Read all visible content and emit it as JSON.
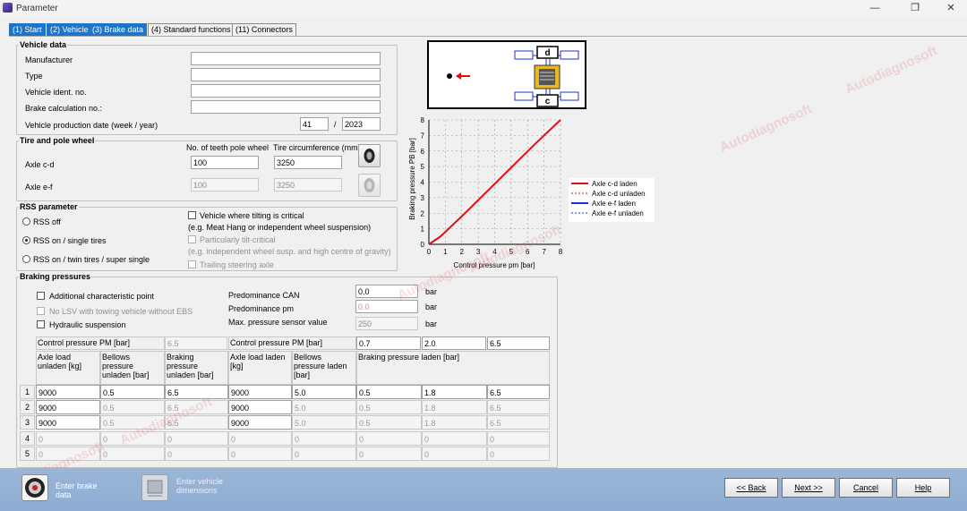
{
  "window": {
    "title": "Parameter",
    "min": "—",
    "max": "❐",
    "close": "✕"
  },
  "tabs": [
    "(1) Start",
    "(2) Vehicle",
    "(3) Brake data",
    "(4) Standard functions",
    "(11) Connectors"
  ],
  "vehicle_data": {
    "title": "Vehicle data",
    "manufacturer": "Manufacturer",
    "type": "Type",
    "ident": "Vehicle ident. no.",
    "calc": "Brake calculation no.:",
    "prod_date": "Vehicle production date (week / year)",
    "week": "41",
    "sep": "/",
    "year": "2023"
  },
  "tire": {
    "title": "Tire and pole wheel",
    "col_teeth": "No. of teeth pole wheel",
    "col_circ": "Tire circumference (mm)",
    "axle_cd": "Axle c-d",
    "axle_ef": "Axle e-f",
    "cd_teeth": "100",
    "cd_circ": "3250",
    "ef_teeth": "100",
    "ef_circ": "3250"
  },
  "rss": {
    "title": "RSS parameter",
    "off": "RSS off",
    "single": "RSS on / single tires",
    "twin": "RSS on / twin tires / super single",
    "tilt": "Vehicle where tilting is critical",
    "tilt_note": "(e.g. Meat Hang or independent wheel suspension)",
    "particular": "Particularly tilt-critical",
    "particular_note": "(e.g. independent wheel susp. and high centre of gravity)",
    "trailing": "Trailing steering axle"
  },
  "braking": {
    "title": "Braking pressures",
    "add_point": "Additional characteristic point",
    "no_lsv": "No LSV with towing vehicle without EBS",
    "hydraulic": "Hydraulic suspension",
    "pred_can": "Predominance CAN",
    "pred_can_val": "0.0",
    "pred_pm": "Predominance pm",
    "pred_pm_val": "0.0",
    "max_sensor": "Max. pressure sensor value",
    "max_sensor_val": "250",
    "unit": "bar",
    "ctrl_pm": "Control pressure PM [bar]",
    "ctrl_pm_val": "6.5",
    "ctrl_pm_laden": [
      "0.7",
      "2.0",
      "6.5"
    ],
    "col_axle_unladen": "Axle load unladen [kg]",
    "col_bellows_unladen": "Bellows pressure unladen [bar]",
    "col_braking_unladen": "Braking pressure unladen [bar]",
    "col_axle_laden": "Axle load laden [kg]",
    "col_bellows_laden": "Bellows pressure laden [bar]",
    "col_braking_laden": "Braking pressure laden [bar]",
    "rows": [
      [
        "1",
        "9000",
        "0.5",
        "6.5",
        "9000",
        "5.0",
        "0.5",
        "1.8",
        "6.5"
      ],
      [
        "2",
        "9000",
        "0.5",
        "6.5",
        "9000",
        "5.0",
        "0.5",
        "1.8",
        "6.5"
      ],
      [
        "3",
        "9000",
        "0.5",
        "6.5",
        "9000",
        "5.0",
        "0.5",
        "1.8",
        "6.5"
      ],
      [
        "4",
        "0",
        "0",
        "0",
        "0",
        "0",
        "0",
        "0",
        "0"
      ],
      [
        "5",
        "0",
        "0",
        "0",
        "0",
        "0",
        "0",
        "0",
        "0"
      ]
    ]
  },
  "diagram": {
    "label_d": "d",
    "label_c": "c"
  },
  "chart_data": {
    "type": "line",
    "xlabel": "Control pressure pm [bar]",
    "ylabel": "Braking pressure PB [bar]",
    "xlim": [
      0,
      8
    ],
    "ylim": [
      0,
      8
    ],
    "xticks": [
      "0",
      "1",
      "2",
      "3",
      "4",
      "5",
      "6",
      "7",
      "8"
    ],
    "yticks": [
      "0",
      "1",
      "2",
      "3",
      "4",
      "5",
      "6",
      "7",
      "8"
    ],
    "grid": true,
    "legend_position": "right",
    "series": [
      {
        "name": "Axle c-d laden",
        "color": "#e01010",
        "style": "solid",
        "x": [
          0,
          0.7,
          2.0,
          6.5,
          8
        ],
        "y": [
          0,
          0.5,
          1.8,
          6.5,
          8
        ]
      }
    ],
    "legend": [
      {
        "name": "Axle c-d laden",
        "color": "#e01010",
        "style": "solid"
      },
      {
        "name": "Axle c-d unladen",
        "color": "#e01010",
        "style": "dashed"
      },
      {
        "name": "Axle e-f laden",
        "color": "#1a2ee0",
        "style": "solid"
      },
      {
        "name": "Axle e-f unladen",
        "color": "#1a2ee0",
        "style": "dashed"
      }
    ]
  },
  "footer": {
    "nav1": "Enter brake data",
    "nav2": "Enter vehicle dimensions",
    "back": "<< Back",
    "next": "Next >>",
    "cancel": "Cancel",
    "help": "Help"
  },
  "watermark": "Autodiagnosoft"
}
